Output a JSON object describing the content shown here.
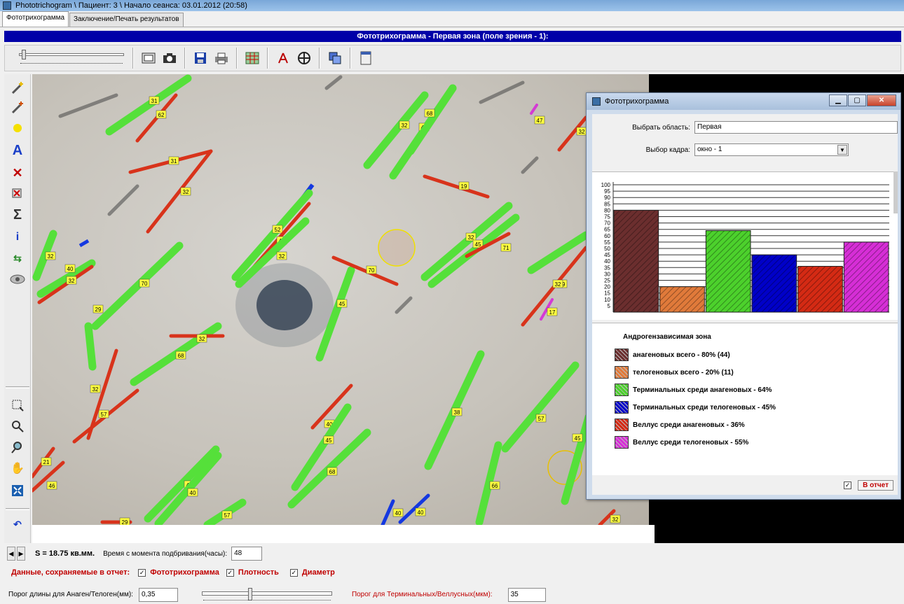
{
  "window": {
    "title": "Phototrichogram  \\  Пациент: 3 \\  Начало сеанса: 03.01.2012 (20:58)"
  },
  "tabs": [
    {
      "label": "Фототрихограмма",
      "active": true
    },
    {
      "label": "Заключение/Печать результатов",
      "active": false
    }
  ],
  "zone_header": "Фототрихограмма - Первая зона (поле зрения - 1):",
  "toolbar_icons": [
    "image-icon",
    "camera-icon",
    "save-icon",
    "print-icon",
    "grid-icon",
    "compass-icon",
    "crosshair-icon",
    "copy-icon",
    "document-icon"
  ],
  "palette_tools": [
    "magic-wand-icon",
    "magic-wand-plus-icon",
    "sun-icon",
    "text-tool-icon",
    "delete-icon",
    "delete-region-icon",
    "sum-icon",
    "info-icon",
    "swap-icon",
    "eye-icon",
    "select-rect-icon",
    "zoom-icon",
    "zoom-out-icon",
    "hand-icon",
    "fit-icon",
    "undo-icon"
  ],
  "hair_labels": [
    "31",
    "62",
    "31",
    "32",
    "32",
    "45",
    "68",
    "47",
    "19",
    "32",
    "32",
    "40",
    "32",
    "29",
    "70",
    "52",
    "45",
    "32",
    "45",
    "70",
    "32",
    "45",
    "71",
    "19",
    "32",
    "17",
    "68",
    "32",
    "32",
    "57",
    "40",
    "45",
    "68",
    "38",
    "57",
    "45",
    "66",
    "45",
    "40",
    "57",
    "21",
    "46",
    "29",
    "40",
    "40",
    "32"
  ],
  "dialog": {
    "title": "Фототрихограмма",
    "area_label": "Выбрать область:",
    "area_value": "Первая",
    "frame_label": "Выбор кадра:",
    "frame_value": "окно - 1",
    "legend_title": "Андрогензависимая зона",
    "report_checkbox_checked": true,
    "report_button": "В отчет"
  },
  "chart_data": {
    "type": "bar",
    "categories": [
      "анагеновых всего",
      "телогеновых всего",
      "Терминальных среди анагеновых",
      "Терминальных среди телогеновых",
      "Веллус среди анагеновых",
      "Веллус среди телогеновых"
    ],
    "values": [
      80,
      20,
      64,
      45,
      36,
      55
    ],
    "colors": [
      "#6b2e2e",
      "#e07a3a",
      "#4cd12c",
      "#0000c8",
      "#d42a14",
      "#d62ed6"
    ],
    "yticks": [
      "100",
      "95",
      "90",
      "85",
      "80",
      "75",
      "70",
      "65",
      "60",
      "55",
      "50",
      "45",
      "40",
      "35",
      "30",
      "25",
      "20",
      "15",
      "10",
      "5"
    ],
    "ylim": [
      0,
      100
    ],
    "legend_labels": [
      "анагеновых всего - 80% (44)",
      "телогеновых всего - 20% (11)",
      "Терминальных среди анагеновых - 64%",
      "Терминальных среди телогеновых - 45%",
      "Веллус среди анагеновых - 36%",
      "Веллус среди телогеновых - 55%"
    ]
  },
  "bottom": {
    "area_text": "S = 18.75 кв.мм.",
    "time_label": "Время с момента подбривания(часы):",
    "time_value": "48",
    "saved_label": "Данные, сохраняемые в отчет:",
    "chk_phototrichogram": "Фототрихограмма",
    "chk_density": "Плотность",
    "chk_diameter": "Диаметр",
    "length_threshold_label": "Порог длины для Анаген/Телоген(мм):",
    "length_threshold_value": "0,35",
    "terminal_threshold_label": "Порог для Терминальных/Веллусных(мкм):",
    "terminal_threshold_value": "35"
  }
}
